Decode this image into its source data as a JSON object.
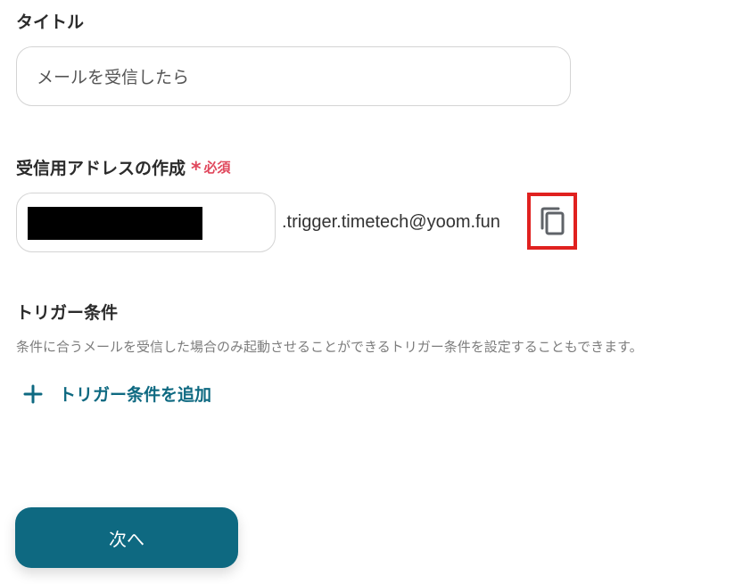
{
  "title_section": {
    "label": "タイトル",
    "input_value": "メールを受信したら"
  },
  "address_section": {
    "label": "受信用アドレスの作成",
    "required_mark": "*",
    "required_label": "必須",
    "domain_suffix": ".trigger.timetech@yoom.fun",
    "copy_icon": "copy-icon"
  },
  "trigger_section": {
    "label": "トリガー条件",
    "description": "条件に合うメールを受信した場合のみ起動させることができるトリガー条件を設定することもできます。",
    "add_label": "トリガー条件を追加",
    "add_icon": "plus-icon"
  },
  "footer": {
    "next_label": "次へ"
  },
  "colors": {
    "accent": "#0e6981",
    "required": "#e0475c",
    "highlight": "#e0211f"
  }
}
